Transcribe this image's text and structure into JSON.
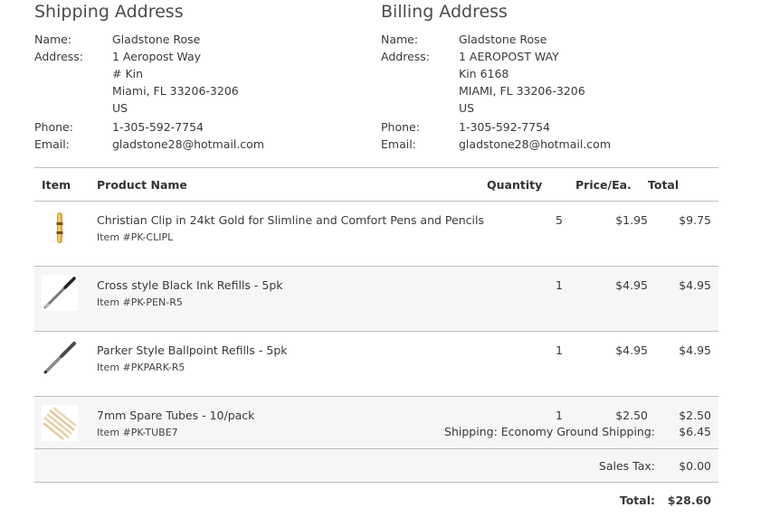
{
  "shipping": {
    "title": "Shipping Address",
    "name_label": "Name:",
    "name": "Gladstone Rose",
    "address_label": "Address:",
    "address_lines": [
      "1 Aeropost Way",
      "# Kin",
      "Miami, FL 33206-3206",
      "US"
    ],
    "phone_label": "Phone:",
    "phone": "1-305-592-7754",
    "email_label": "Email:",
    "email": "gladstone28@hotmail.com"
  },
  "billing": {
    "title": "Billing Address",
    "name_label": "Name:",
    "name": "Gladstone Rose",
    "address_label": "Address:",
    "address_lines": [
      "1 AEROPOST WAY",
      "Kin 6168",
      "MIAMI, FL 33206-3206",
      "US"
    ],
    "phone_label": "Phone:",
    "phone": "1-305-592-7754",
    "email_label": "Email:",
    "email": "gladstone28@hotmail.com"
  },
  "table": {
    "headers": {
      "item": "Item",
      "product": "Product Name",
      "quantity": "Quantity",
      "price": "Price/Ea.",
      "total": "Total"
    },
    "rows": [
      {
        "name": "Christian Clip in 24kt Gold for Slimline and Comfort Pens and Pencils",
        "code": "Item #PK-CLIPL",
        "qty": "5",
        "price": "$1.95",
        "total": "$9.75",
        "icon": "gold-clip-icon"
      },
      {
        "name": "Cross style Black Ink Refills - 5pk",
        "code": "Item #PK-PEN-R5",
        "qty": "1",
        "price": "$4.95",
        "total": "$4.95",
        "icon": "refill-icon"
      },
      {
        "name": "Parker Style Ballpoint Refills - 5pk",
        "code": "Item #PKPARK-R5",
        "qty": "1",
        "price": "$4.95",
        "total": "$4.95",
        "icon": "ballpoint-refill-icon"
      },
      {
        "name": "7mm Spare Tubes - 10/pack",
        "code": "Item #PK-TUBE7",
        "qty": "1",
        "price": "$2.50",
        "total": "$2.50",
        "icon": "spare-tubes-icon"
      }
    ]
  },
  "summary": {
    "shipping_label": "Shipping: Economy Ground Shipping:",
    "shipping": "$6.45",
    "tax_label": "Sales Tax:",
    "tax": "$0.00",
    "total_label": "Total:",
    "total": "$28.60"
  }
}
